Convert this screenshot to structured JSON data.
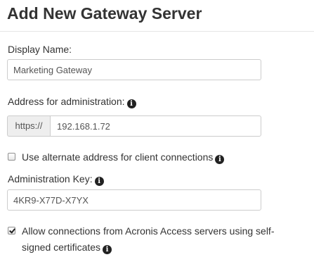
{
  "page": {
    "title": "Add New Gateway Server"
  },
  "display_name": {
    "label": "Display Name:",
    "value": "Marketing Gateway"
  },
  "admin_address": {
    "label": "Address for administration:",
    "prefix": "https://",
    "value": "192.168.1.72"
  },
  "alternate_address": {
    "label": "Use alternate address for client connections",
    "checked": false
  },
  "admin_key": {
    "label": "Administration Key:",
    "value": "4KR9-X77D-X7YX"
  },
  "self_signed": {
    "label_line1": "Allow connections from Acronis Access servers using self-",
    "label_line2": "signed certificates",
    "checked": true
  },
  "icons": {
    "info": "info-icon"
  },
  "colors": {
    "addon_background": "#eeeeee",
    "input_border": "#cccccc",
    "text": "#333333"
  }
}
